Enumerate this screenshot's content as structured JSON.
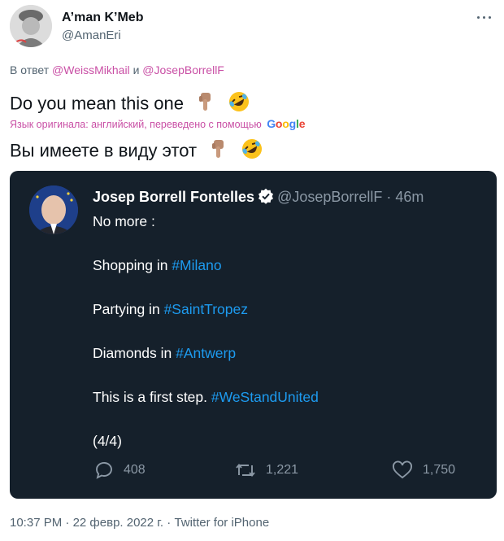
{
  "author": {
    "display_name": "A’man K’Meb",
    "handle": "@AmanEri"
  },
  "reply": {
    "prefix": "В ответ",
    "mention1": "@WeissMikhail",
    "conjunction": "и",
    "mention2": "@JosepBorrellF"
  },
  "tweet": {
    "text": "Do you mean this one"
  },
  "translation": {
    "note": "Язык оригинала: английский, переведено с помощью",
    "provider": "Google",
    "text": "Вы имеете в виду этот"
  },
  "quoted": {
    "name": "Josep Borrell Fontelles",
    "handle": "@JosepBorrellF · 46m",
    "line1": "No more :",
    "line2_text": "Shopping in",
    "line2_tag": "#Milano",
    "line3_text": "Partying in",
    "line3_tag": "#SaintTropez",
    "line4_text": "Diamonds in",
    "line4_tag": "#Antwerp",
    "line5_text": "This is a first step.",
    "line5_tag": "#WeStandUnited",
    "line6": "(4/4)",
    "replies": "408",
    "retweets": "1,221",
    "likes": "1,750"
  },
  "footer": {
    "time": "10:37 PM",
    "date": "22 февр. 2022 г.",
    "source": "Twitter for iPhone"
  },
  "colors": {
    "mention": "#c94fa5",
    "card_bg": "#15202b",
    "hashtag": "#1d9bf0",
    "verified": "#ffffff"
  }
}
